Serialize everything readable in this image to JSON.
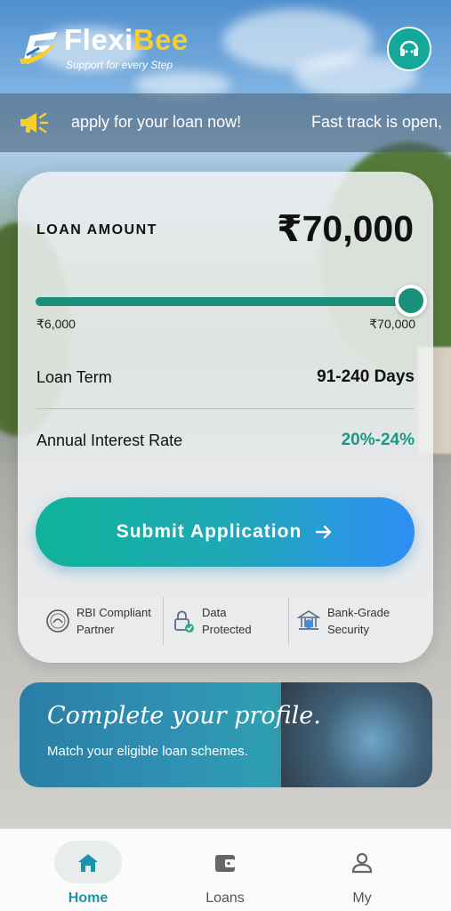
{
  "header": {
    "brand_part1": "Flexi",
    "brand_part2": "Bee",
    "tagline": "Support for every Step",
    "support_icon": "headset-icon"
  },
  "announcement": {
    "icon": "megaphone-icon",
    "text_1": "apply for your loan now!",
    "text_2": "Fast track is open,"
  },
  "loan_card": {
    "amount_label": "LOAN AMOUNT",
    "amount_value": "₹70,000",
    "slider": {
      "min_label": "₹6,000",
      "max_label": "₹70,000",
      "level_fraction": 1.0
    },
    "term_label": "Loan Term",
    "term_value": "91-240 Days",
    "rate_label": "Annual Interest Rate",
    "rate_value": "20%-24%",
    "submit_label": "Submit Application",
    "badges": [
      {
        "icon": "rbi-seal-icon",
        "line1": "RBI Compliant",
        "line2": "Partner"
      },
      {
        "icon": "lock-check-icon",
        "line1": "Data",
        "line2": "Protected"
      },
      {
        "icon": "bank-shield-icon",
        "line1": "Bank-Grade",
        "line2": "Security"
      }
    ]
  },
  "banner": {
    "title": "Complete your profile.",
    "subtitle": "Match your eligible loan schemes."
  },
  "bottom_nav": {
    "items": [
      {
        "label": "Home",
        "icon": "home-icon",
        "active": true
      },
      {
        "label": "Loans",
        "icon": "wallet-icon",
        "active": false
      },
      {
        "label": "My",
        "icon": "person-icon",
        "active": false
      }
    ]
  },
  "colors": {
    "accent_teal": "#1a8f7a",
    "button_gradient_start": "#10b39a",
    "button_gradient_end": "#2f8ef5",
    "brand_yellow": "#f6cf2e",
    "active_nav": "#1a93a6"
  }
}
